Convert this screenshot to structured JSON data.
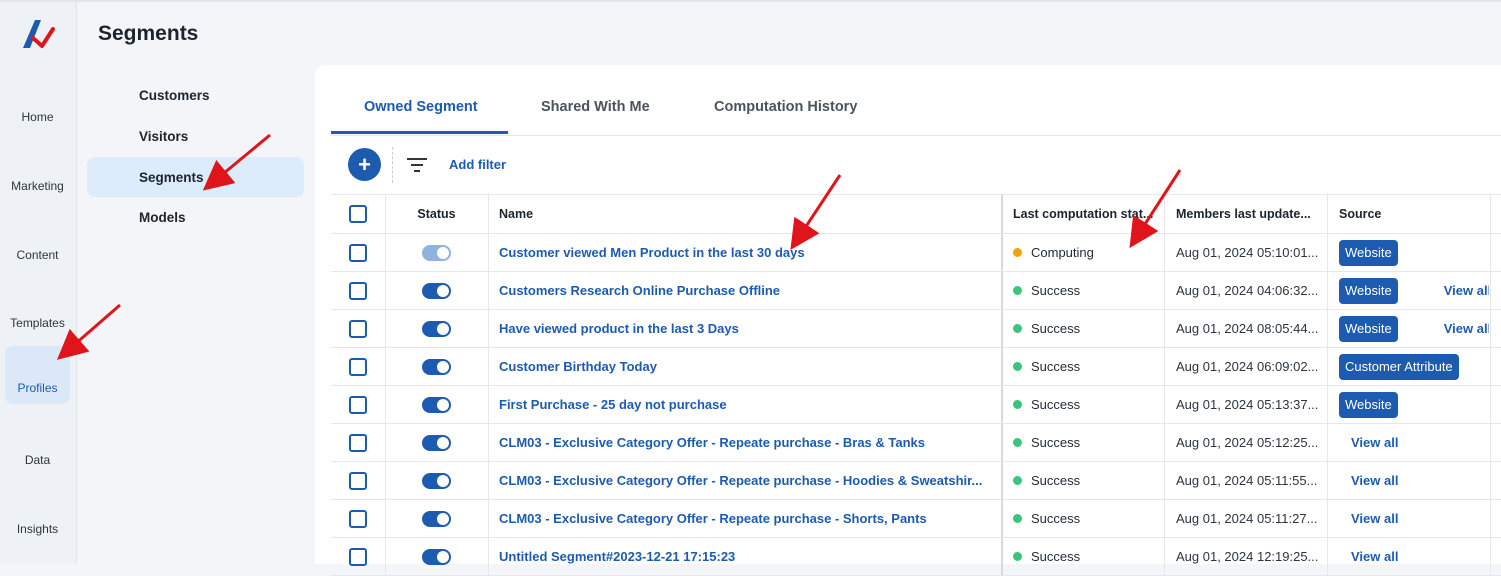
{
  "app": {
    "page_title": "Segments"
  },
  "rail": {
    "items": [
      {
        "label": "Home",
        "icon": "home-icon"
      },
      {
        "label": "Marketing",
        "icon": "route-icon"
      },
      {
        "label": "Content",
        "icon": "document-icon"
      },
      {
        "label": "Templates",
        "icon": "palette-icon"
      },
      {
        "label": "Profiles",
        "icon": "profile-badge-icon",
        "active": true
      },
      {
        "label": "Data",
        "icon": "database-icon"
      },
      {
        "label": "Insights",
        "icon": "bar-chart-icon"
      }
    ]
  },
  "subnav": {
    "items": [
      {
        "label": "Customers",
        "icon": "basket-icon"
      },
      {
        "label": "Visitors",
        "icon": "visitor-badge-icon"
      },
      {
        "label": "Segments",
        "icon": "pie-chart-icon",
        "active": true
      },
      {
        "label": "Models",
        "icon": "shapes-icon"
      }
    ]
  },
  "tabs": [
    "Owned Segment",
    "Shared With Me",
    "Computation History"
  ],
  "toolbar": {
    "add_label": "+",
    "add_filter_label": "Add filter"
  },
  "table": {
    "headers": {
      "status": "Status",
      "name": "Name",
      "last_status": "Last computation stat...",
      "updated": "Members last update...",
      "source": "Source"
    },
    "rows": [
      {
        "name": "Customer viewed Men Product in the last 30 days",
        "status": "Computing",
        "updated": "Aug 01, 2024 05:10:01...",
        "badge": "Website",
        "view_all": "",
        "active": "pending"
      },
      {
        "name": "Customers Research Online Purchase Offline",
        "status": "Success",
        "updated": "Aug 01, 2024 04:06:32...",
        "badge": "Website",
        "view_all": "View all",
        "active": "on"
      },
      {
        "name": "Have viewed product in the last 3 Days",
        "status": "Success",
        "updated": "Aug 01, 2024 08:05:44...",
        "badge": "Website",
        "view_all": "View all",
        "active": "on"
      },
      {
        "name": "Customer Birthday Today",
        "status": "Success",
        "updated": "Aug 01, 2024 06:09:02...",
        "badge": "Customer Attribute",
        "view_all": "",
        "active": "on"
      },
      {
        "name": "First Purchase - 25 day not purchase",
        "status": "Success",
        "updated": "Aug 01, 2024 05:13:37...",
        "badge": "Website",
        "view_all": "",
        "active": "on"
      },
      {
        "name": "CLM03 - Exclusive Category Offer - Repeate purchase - Bras & Tanks",
        "status": "Success",
        "updated": "Aug 01, 2024 05:12:25...",
        "badge": "",
        "view_all": "View all",
        "active": "on"
      },
      {
        "name": "CLM03 - Exclusive Category Offer - Repeate purchase - Hoodies & Sweatshir...",
        "status": "Success",
        "updated": "Aug 01, 2024 05:11:55...",
        "badge": "",
        "view_all": "View all",
        "active": "on"
      },
      {
        "name": "CLM03 - Exclusive Category Offer - Repeate purchase - Shorts, Pants",
        "status": "Success",
        "updated": "Aug 01, 2024 05:11:27...",
        "badge": "",
        "view_all": "View all",
        "active": "on"
      },
      {
        "name": "Untitled Segment#2023-12-21 17:15:23",
        "status": "Success",
        "updated": "Aug 01, 2024 12:19:25...",
        "badge": "",
        "view_all": "View all",
        "active": "on"
      }
    ]
  },
  "colors": {
    "accent": "#1d5bb0",
    "computing": "#f0a30a",
    "success": "#3cc47c",
    "annotation": "#e0141b"
  }
}
